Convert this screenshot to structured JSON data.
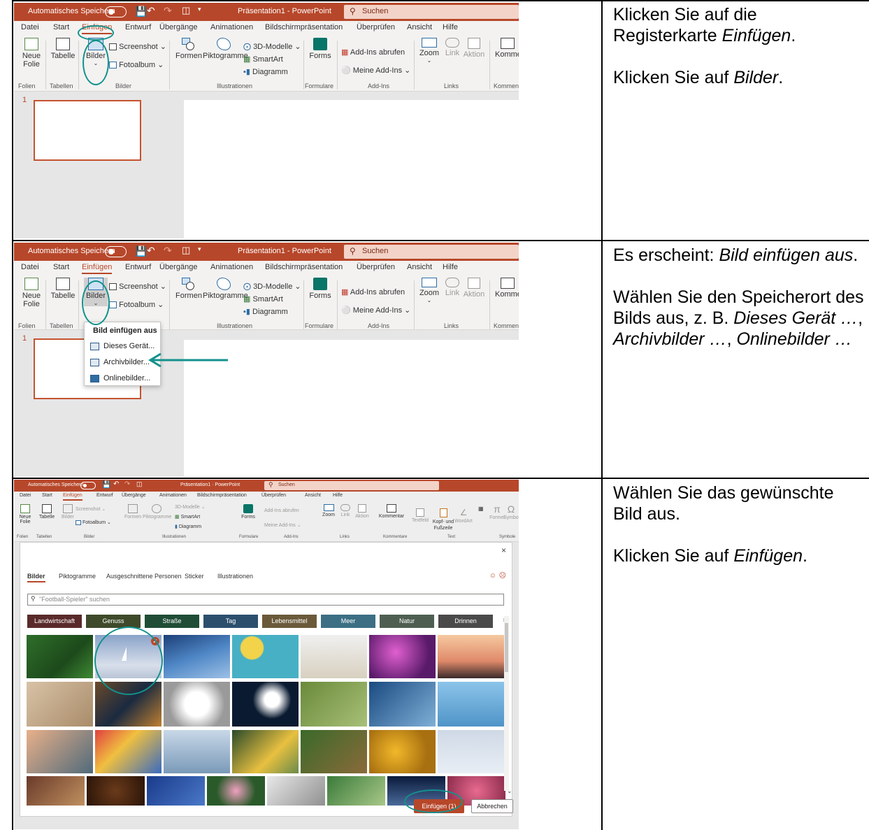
{
  "rows": [
    {
      "instructions": [
        {
          "parts": [
            {
              "t": "Klicken Sie auf die Registerkarte ",
              "i": false
            },
            {
              "t": "Einfügen",
              "i": true
            },
            {
              "t": ".",
              "i": false
            }
          ]
        },
        {
          "gap": true
        },
        {
          "parts": [
            {
              "t": "Klicken Sie auf ",
              "i": false
            },
            {
              "t": "Bilder",
              "i": true
            },
            {
              "t": ".",
              "i": false
            }
          ]
        }
      ]
    },
    {
      "instructions": [
        {
          "parts": [
            {
              "t": "Es erscheint: ",
              "i": false
            },
            {
              "t": "Bild einfügen aus",
              "i": true
            },
            {
              "t": ".",
              "i": false
            }
          ]
        },
        {
          "gap": true
        },
        {
          "parts": [
            {
              "t": "Wählen Sie den Speicherort des Bilds aus, z. B. ",
              "i": false
            },
            {
              "t": "Dieses Gerät …",
              "i": true
            },
            {
              "t": ", ",
              "i": false
            },
            {
              "t": "Archivbilder …",
              "i": true
            },
            {
              "t": ", ",
              "i": false
            },
            {
              "t": "Onlinebilder …",
              "i": true
            }
          ]
        }
      ]
    },
    {
      "instructions": [
        {
          "parts": [
            {
              "t": "Wählen Sie das gewünschte Bild aus.",
              "i": false
            }
          ]
        },
        {
          "gap": true
        },
        {
          "parts": [
            {
              "t": "Klicken Sie auf ",
              "i": false
            },
            {
              "t": "Einfügen",
              "i": true
            },
            {
              "t": ".",
              "i": false
            }
          ]
        }
      ]
    }
  ],
  "ppt": {
    "autosave": "Automatisches Speichern",
    "title": "Präsentation1 - PowerPoint",
    "title_short": "Präsentation1 · PowerPoint",
    "search": "Suchen",
    "tabs": [
      "Datei",
      "Start",
      "Einfügen",
      "Entwurf",
      "Übergänge",
      "Animationen",
      "Bildschirmpräsentation",
      "Überprüfen",
      "Ansicht",
      "Hilfe"
    ],
    "ribbon": {
      "neue_folie": "Neue",
      "folie": "Folie",
      "tabelle": "Tabelle",
      "bilder": "Bilder",
      "screenshot": "Screenshot",
      "fotoalbum": "Fotoalbum",
      "formen": "Formen",
      "piktogramme": "Piktogramme",
      "modelle3d": "3D-Modelle",
      "smartart": "SmartArt",
      "diagramm": "Diagramm",
      "forms": "Forms",
      "addins_abrufen": "Add-Ins abrufen",
      "meine_addins": "Meine Add-Ins",
      "zoom": "Zoom",
      "link": "Link",
      "aktion": "Aktion",
      "kommentar_cut": "Kommer",
      "kommentar": "Kommentar",
      "textfeld": "Textfeld",
      "kopf_fuss": "Kopf- und Fußzeile",
      "wordart": "WordArt",
      "formel": "Formel",
      "symbol": "Symbol"
    },
    "groups": {
      "folien": "Folien",
      "tabellen": "Tabellen",
      "bilder": "Bilder",
      "illustrationen": "Illustrationen",
      "formulare": "Formulare",
      "addins": "Add-Ins",
      "links": "Links",
      "komment_cut": "Komment",
      "kommentare": "Kommentare",
      "text": "Text",
      "symbole": "Symbole"
    },
    "slide_number": "1",
    "menu": {
      "header": "Bild einfügen aus",
      "items": [
        "Dieses Gerät...",
        "Archivbilder...",
        "Onlinebilder..."
      ]
    },
    "dialog": {
      "tabs": [
        "Bilder",
        "Piktogramme",
        "Ausgeschnittene Personen",
        "Sticker",
        "Illustrationen"
      ],
      "search_placeholder": "\"Football-Spieler\" suchen",
      "categories": [
        "Landwirtschaft",
        "Genuss",
        "Straße",
        "Tag",
        "Lebensmittel",
        "Meer",
        "Natur",
        "Drinnen"
      ],
      "insert_button": "Einfügen (1)",
      "cancel_button": "Abbrechen"
    }
  },
  "colors": {
    "accent": "#b7472a",
    "annotation": "#13928c"
  }
}
